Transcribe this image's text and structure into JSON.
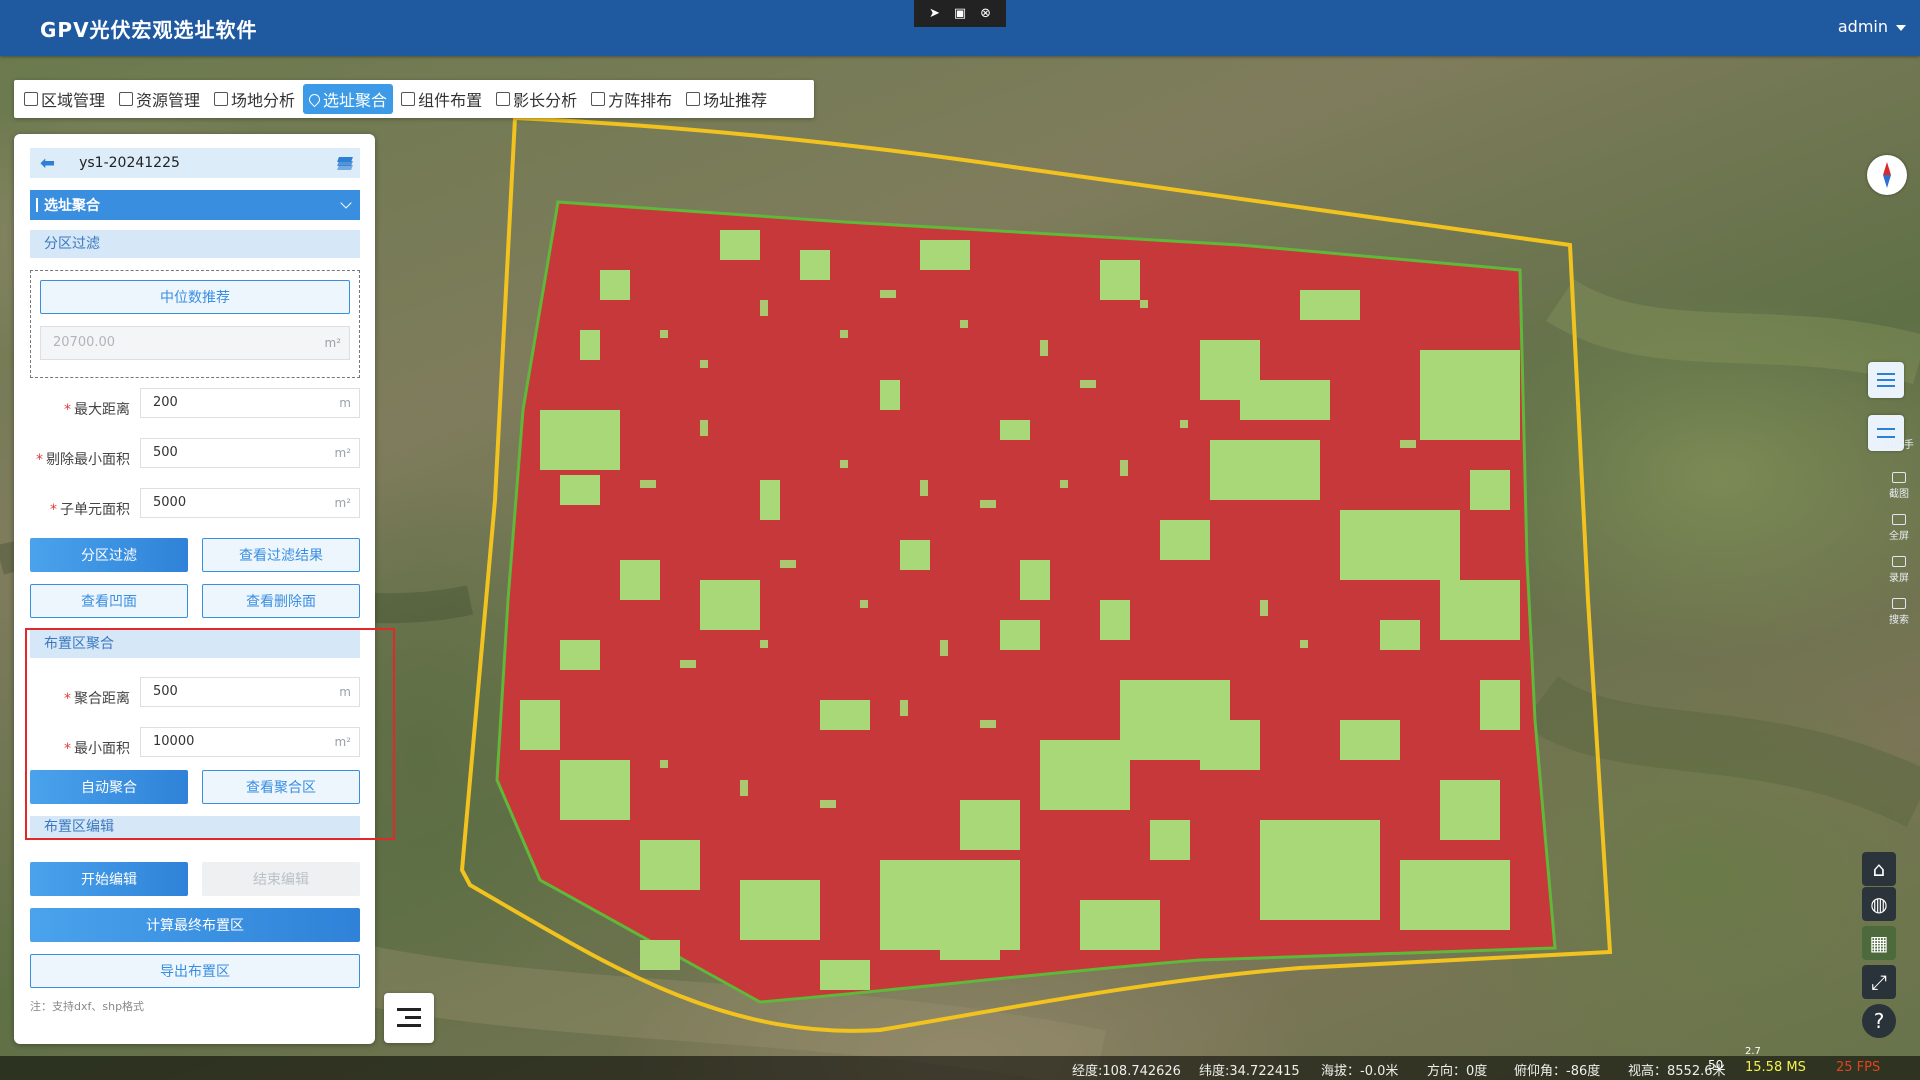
{
  "app": {
    "title": "GPV光伏宏观选址软件",
    "user": "admin"
  },
  "window_controls": {
    "icons": [
      "pointer-icon",
      "screen-icon",
      "close-icon"
    ]
  },
  "tabs": [
    {
      "label": "区域管理",
      "icon": "region-icon",
      "active": false
    },
    {
      "label": "资源管理",
      "icon": "resource-icon",
      "active": false
    },
    {
      "label": "场地分析",
      "icon": "terrain-icon",
      "active": false
    },
    {
      "label": "选址聚合",
      "icon": "location-pin-icon",
      "active": true
    },
    {
      "label": "组件布置",
      "icon": "component-icon",
      "active": false
    },
    {
      "label": "影长分析",
      "icon": "shadow-icon",
      "active": false
    },
    {
      "label": "方阵排布",
      "icon": "array-icon",
      "active": false
    },
    {
      "label": "场址推荐",
      "icon": "recommend-icon",
      "active": false
    }
  ],
  "panel": {
    "project_name": "ys1-20241225",
    "section": "选址聚合",
    "filter": {
      "header": "分区过滤",
      "median_button": "中位数推荐",
      "median_value": "20700.00",
      "median_unit": "m²",
      "fields": [
        {
          "label": "最大距离",
          "value": "200",
          "unit": "m"
        },
        {
          "label": "剔除最小面积",
          "value": "500",
          "unit": "m²"
        },
        {
          "label": "子单元面积",
          "value": "5000",
          "unit": "m²"
        }
      ],
      "btn_filter": "分区过滤",
      "btn_view_result": "查看过滤结果",
      "btn_view_concave": "查看凹面",
      "btn_view_deleted": "查看删除面"
    },
    "aggregate": {
      "header": "布置区聚合",
      "fields": [
        {
          "label": "聚合距离",
          "value": "500",
          "unit": "m"
        },
        {
          "label": "最小面积",
          "value": "10000",
          "unit": "m²"
        }
      ],
      "btn_auto": "自动聚合",
      "btn_view": "查看聚合区"
    },
    "edit": {
      "header": "布置区编辑",
      "btn_start": "开始编辑",
      "btn_end": "结束编辑",
      "btn_compute": "计算最终布置区",
      "btn_export": "导出布置区",
      "note": "注：支持dxf、shp格式"
    }
  },
  "right_tools": [
    {
      "label": "AI助手",
      "icon": "ai-icon"
    },
    {
      "label": "截图",
      "icon": "camera-icon"
    },
    {
      "label": "全屏",
      "icon": "fullscreen-screen-icon"
    },
    {
      "label": "录屏",
      "icon": "record-icon"
    },
    {
      "label": "搜索",
      "icon": "search-icon"
    }
  ],
  "status_bar": {
    "longitude": "经度:108.742626",
    "latitude": "纬度:34.722415",
    "altitude": "海拔：-0.0米",
    "heading": "方向：0度",
    "pitch": "俯仰角：-86度",
    "view_height": "视高：8552.6米",
    "scale_value": "50",
    "ms": "15.58 MS",
    "scale_small": "2.7",
    "fps": "25 FPS"
  },
  "colors": {
    "header": "#1f5aa0",
    "accent": "#3a8ee0",
    "map_red": "#c7383a",
    "map_green": "#a8d878",
    "boundary_yellow": "#f2c21f",
    "boundary_green": "#5fb83a",
    "highlight": "#e02a2a"
  }
}
